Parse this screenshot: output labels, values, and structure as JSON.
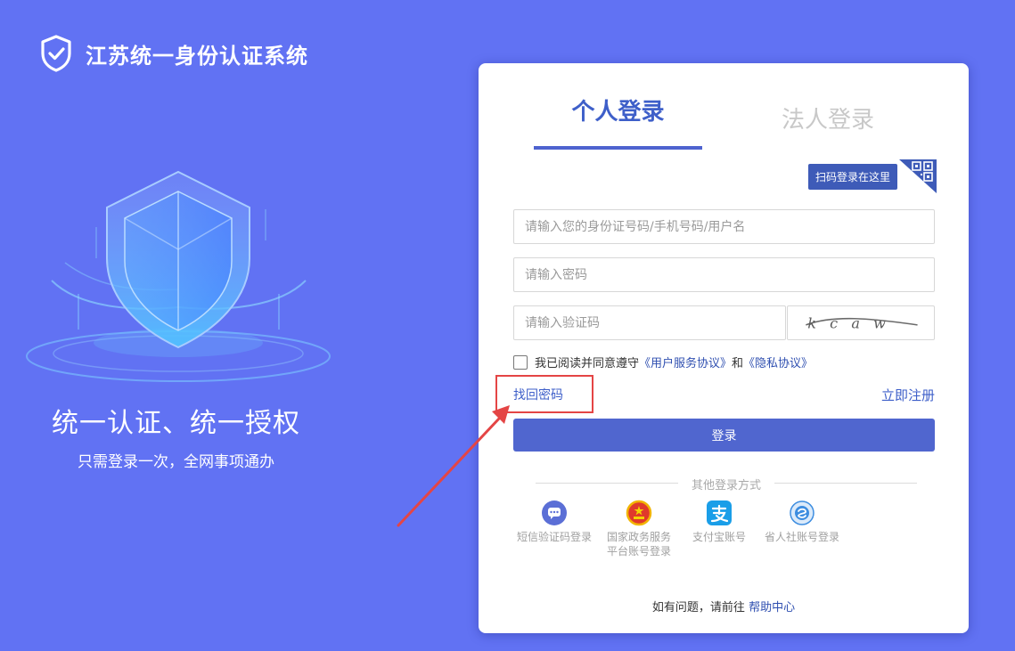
{
  "brand": {
    "title": "江苏统一身份认证系统",
    "icon": "shield-check-icon"
  },
  "slogan": {
    "main": "统一认证、统一授权",
    "sub": "只需登录一次，全网事项通办"
  },
  "login": {
    "tabs": {
      "personal": "个人登录",
      "legal": "法人登录",
      "active": "personal"
    },
    "qr_label": "扫码登录在这里",
    "username_placeholder": "请输入您的身份证号码/手机号码/用户名",
    "password_placeholder": "请输入密码",
    "captcha_placeholder": "请输入验证码",
    "captcha_text": "kcaw",
    "agree": {
      "prefix": "我已阅读并同意遵守",
      "user_agreement": "《用户服务协议》",
      "and": "和",
      "privacy": "《隐私协议》",
      "checked": false
    },
    "find_password": "找回密码",
    "register": "立即注册",
    "submit": "登录",
    "other_methods_title": "其他登录方式",
    "other_methods": [
      {
        "label": "短信验证码登录",
        "icon": "sms-icon"
      },
      {
        "label": "国家政务服务平台账号登录",
        "icon": "national-emblem-icon"
      },
      {
        "label": "支付宝账号",
        "icon": "alipay-icon"
      },
      {
        "label": "省人社账号登录",
        "icon": "social-security-icon"
      }
    ],
    "help": {
      "prefix": "如有问题，请前往",
      "link": "帮助中心"
    }
  },
  "colors": {
    "background": "#6172f3",
    "primary": "#5066cf",
    "annotation": "#e44545"
  }
}
